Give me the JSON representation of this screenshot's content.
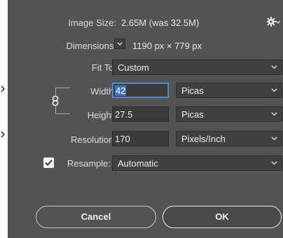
{
  "image_size": {
    "label": "Image Size:",
    "value": "2.65M (was 32.5M)"
  },
  "dimensions": {
    "label": "Dimensions:",
    "value": "1190 px  ×  779 px"
  },
  "fit_to": {
    "label": "Fit To:",
    "value": "Custom"
  },
  "width": {
    "label": "Width:",
    "value": "42",
    "unit": "Picas"
  },
  "height": {
    "label": "Height:",
    "value": "27.5",
    "unit": "Picas"
  },
  "resolution": {
    "label": "Resolution:",
    "value": "170",
    "unit": "Pixels/Inch"
  },
  "resample": {
    "label": "Resample:",
    "value": "Automatic",
    "checked": true
  },
  "buttons": {
    "cancel": "Cancel",
    "ok": "OK"
  }
}
